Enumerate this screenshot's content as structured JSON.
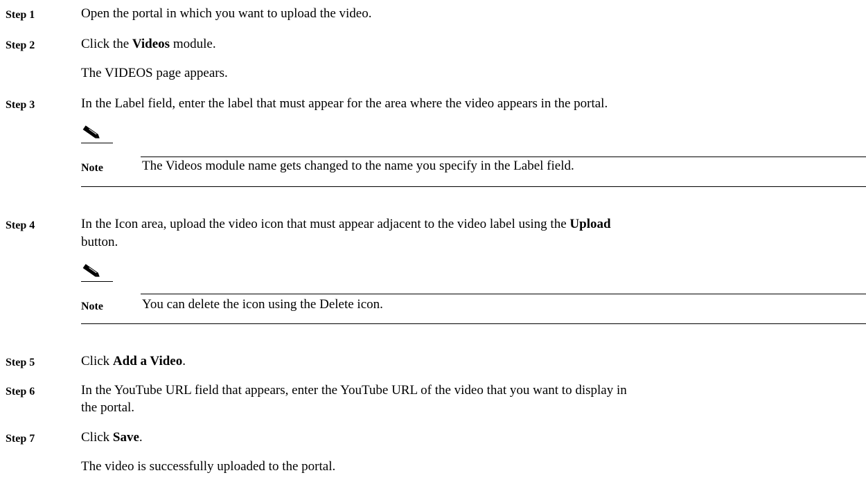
{
  "steps": [
    {
      "label": "Step 1",
      "text": "Open the portal in which you want to upload the video."
    },
    {
      "label": "Step 2",
      "text_pre": "Click the ",
      "text_bold": "Videos",
      "text_post": " module.",
      "result": "The VIDEOS page appears."
    },
    {
      "label": "Step 3",
      "text": "In the Label field, enter the label that must appear for the area where the video appears in the portal.",
      "note": {
        "label": "Note",
        "text": "The Videos module name gets changed to the name you specify in the Label field."
      }
    },
    {
      "label": "Step 4",
      "text_pre": "In the Icon area, upload the video icon that must appear adjacent to the video label using the ",
      "text_bold": "Upload",
      "text_line2": "button.",
      "note": {
        "label": "Note",
        "text": "You can delete the icon using the Delete icon."
      }
    },
    {
      "label": "Step 5",
      "text_pre": "Click ",
      "text_bold": "Add a Video",
      "text_post": "."
    },
    {
      "label": "Step 6",
      "text": "In the YouTube URL field that appears, enter the YouTube URL of the video that you want to display in",
      "text_line2": "the portal."
    },
    {
      "label": "Step 7",
      "text_pre": "Click ",
      "text_bold": "Save",
      "text_post": ".",
      "result": "The video is successfully uploaded to the portal."
    }
  ],
  "icons": {
    "note": "pencil-note-icon"
  }
}
